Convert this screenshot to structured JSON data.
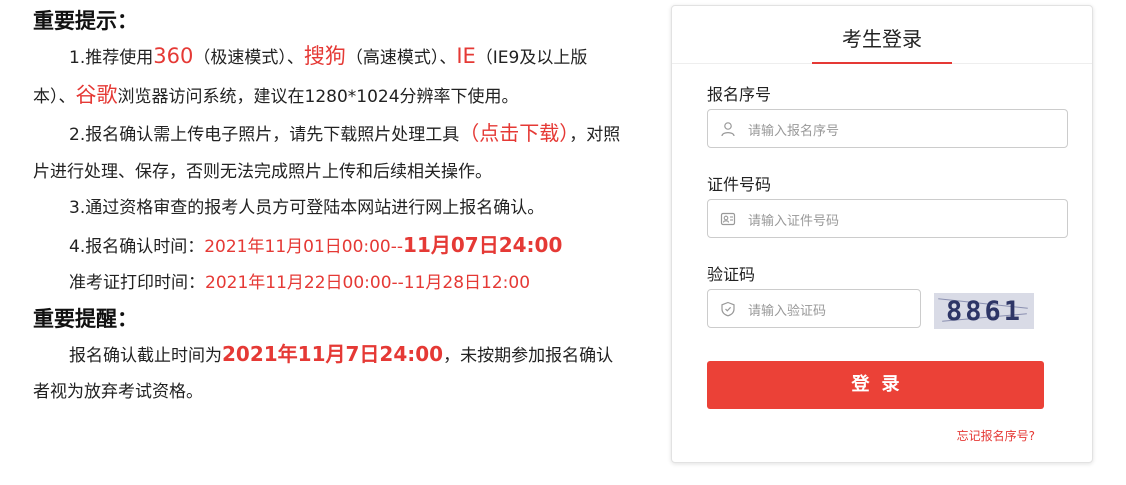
{
  "notice": {
    "heading1": "重要提示：",
    "p1": {
      "a": "1.推荐使用",
      "b1": "360",
      "c": "（极速模式）、",
      "b2": "搜狗",
      "d": "（高速模式）、",
      "b3": "IE",
      "e": "（IE9及以上版本）、",
      "b4": "谷歌",
      "f": "浏览器访问系统，建议在1280*1024分辨率下使用。"
    },
    "p2": {
      "a": "2.报名确认需上传电子照片，请先下载照片处理工具",
      "link": "（点击下载）",
      "b": "，对照片进行处理、保存，否则无法完成照片上传和后续相关操作。"
    },
    "p3": "3.通过资格审查的报考人员方可登陆本网站进行网上报名确认。",
    "p4": {
      "label": "4.报名确认时间：",
      "start": "2021年11月01日00:00--",
      "end": "11月07日24:00"
    },
    "p5": {
      "label": "准考证打印时间：",
      "range": "2021年11月22日00:00--11月28日12:00"
    },
    "heading2": "重要提醒：",
    "p6": {
      "a": "报名确认截止时间为",
      "b": "2021年11月7日24:00",
      "c": "，未按期参加报名确认者视为放弃考试资格。"
    }
  },
  "login": {
    "title": "考生登录",
    "reg_label": "报名序号",
    "reg_placeholder": "请输入报名序号",
    "id_label": "证件号码",
    "id_placeholder": "请输入证件号码",
    "captcha_label": "验证码",
    "captcha_placeholder": "请输入验证码",
    "captcha_text": "8861",
    "submit_label": "登录",
    "forgot_label": "忘记报名序号?"
  },
  "colors": {
    "accent": "#e53935",
    "button": "#eb4137"
  }
}
